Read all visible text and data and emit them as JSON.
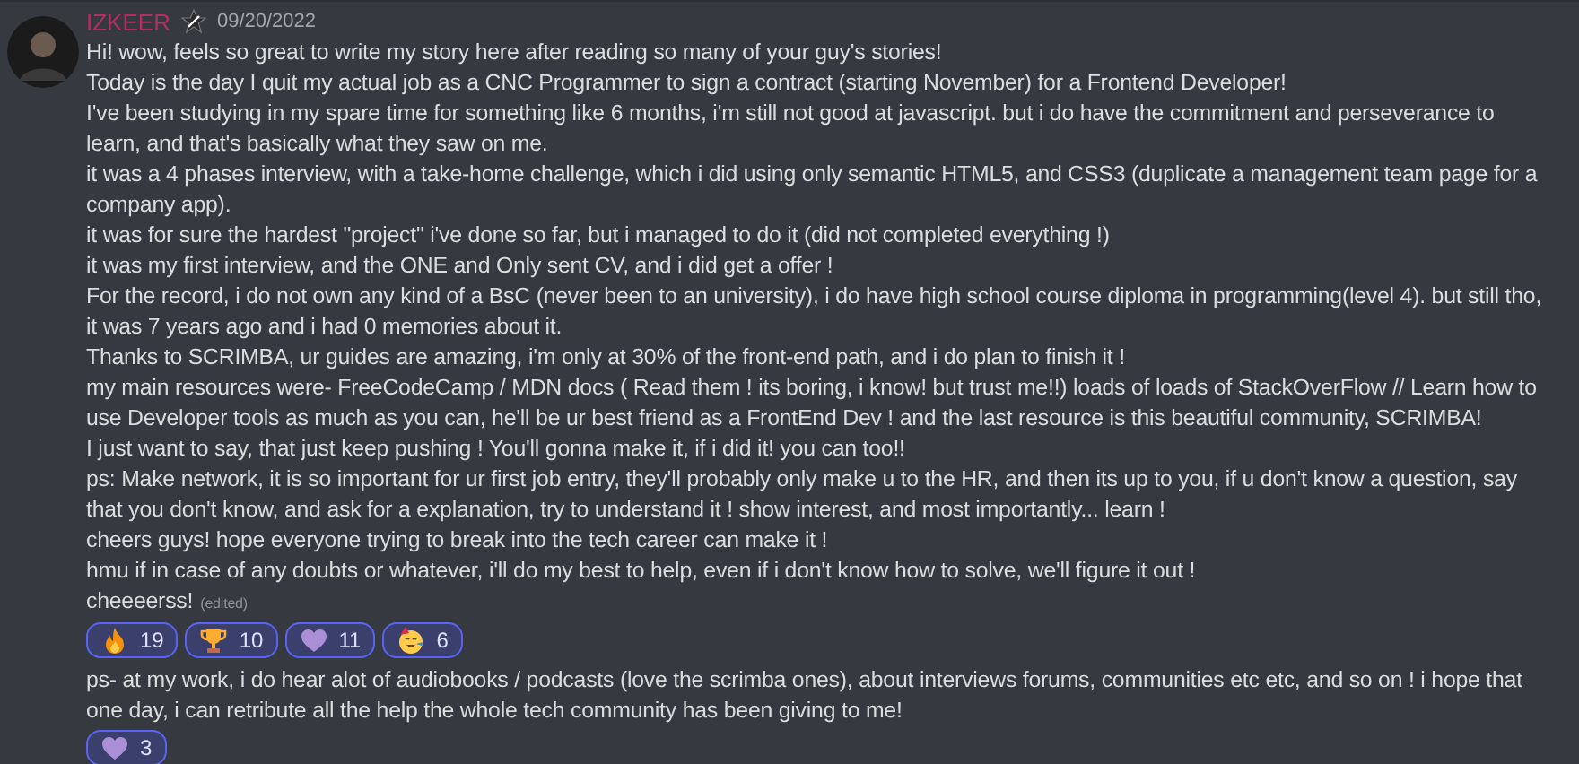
{
  "messages": [
    {
      "author": "IZKEER",
      "badge": true,
      "timestamp": "09/20/2022",
      "edited_label": "(edited)",
      "lines": [
        "Hi! wow, feels so great to write my story here after reading so many of your guy's stories!",
        "Today is the day I quit my actual job as a CNC Programmer to sign a contract (starting November) for a Frontend Developer!",
        "I've been studying in my spare time for something like 6 months, i'm still not good at javascript. but i do have the commitment and perseverance to learn, and that's basically what they saw on me.",
        "it was a 4 phases interview, with a take-home challenge, which i did using only semantic HTML5, and CSS3 (duplicate a management team page for a company app).",
        "it was for sure the hardest \"project\" i've done so far, but i managed to do it (did not completed everything !)",
        " it was my first interview, and the ONE and Only sent CV, and i did get a offer !",
        "For the record, i do not own any kind of a BsC (never been to an university), i do have high school course diploma in programming(level 4). but still tho, it was 7 years ago and i had 0 memories about it.",
        "Thanks to SCRIMBA, ur guides are amazing, i'm only at 30% of the front-end path, and i do plan to finish it !",
        "my main resources were- FreeCodeCamp / MDN docs ( Read them ! its boring, i know! but trust me!!) loads of loads of StackOverFlow // Learn how to use Developer tools as much as you can, he'll be ur best friend as a FrontEnd Dev ! and the last resource is this beautiful community, SCRIMBA!",
        "I just want to say, that just keep pushing ! You'll gonna make it, if i did it! you can too!!",
        "ps: Make network, it is so important for ur first job entry, they'll probably only make u to the HR, and then its up to you, if u don't know a question, say that you don't know, and ask for a explanation, try to understand it ! show interest, and most importantly... learn !",
        "cheers guys! hope everyone trying to break into the tech career can make it !",
        "hmu if in case of any doubts or whatever, i'll do my best to help, even if i don't know how to solve, we'll figure it out !",
        "cheeeerss!"
      ],
      "reactions": [
        {
          "kind": "fire",
          "count": "19",
          "reacted": true
        },
        {
          "kind": "trophy",
          "count": "10",
          "reacted": true
        },
        {
          "kind": "heart",
          "count": "11",
          "reacted": true
        },
        {
          "kind": "party",
          "count": "6",
          "reacted": true
        }
      ]
    },
    {
      "lines": [
        "ps- at my work, i do hear alot of audiobooks / podcasts (love the scrimba ones), about interviews forums, communities etc etc, and so on ! i hope that one day, i can retribute all the help the whole tech community has been giving to me!"
      ],
      "reactions": [
        {
          "kind": "heart",
          "count": "3",
          "reacted": true
        }
      ]
    }
  ]
}
